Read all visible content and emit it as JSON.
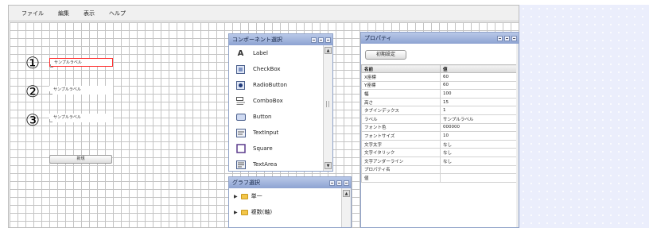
{
  "menu": [
    "ファイル",
    "編集",
    "表示",
    "ヘルプ"
  ],
  "canvas": {
    "markers": [
      "①",
      "②",
      "③"
    ],
    "labels": [
      "サンプルラベル",
      "サンプルラベル",
      "サンプルラベル"
    ],
    "button_label": "新規"
  },
  "components_panel": {
    "title": "コンポーネント選択",
    "items": [
      {
        "label": "Label",
        "icon": "label-a-icon"
      },
      {
        "label": "CheckBox",
        "icon": "checkbox-icon"
      },
      {
        "label": "RadioButton",
        "icon": "radio-button-icon"
      },
      {
        "label": "ComboBox",
        "icon": "combobox-icon"
      },
      {
        "label": "Button",
        "icon": "button-icon"
      },
      {
        "label": "TextInput",
        "icon": "text-input-icon"
      },
      {
        "label": "Square",
        "icon": "square-icon"
      },
      {
        "label": "TextArea",
        "icon": "text-area-icon"
      }
    ]
  },
  "graph_panel": {
    "title": "グラフ選択",
    "items": [
      "単一",
      "複数(軸)"
    ]
  },
  "properties_panel": {
    "title": "プロパティ",
    "button_label": "初期設定",
    "headers": [
      "名前",
      "値"
    ],
    "rows": [
      [
        "X座標",
        "60"
      ],
      [
        "Y座標",
        "60"
      ],
      [
        "幅",
        "100"
      ],
      [
        "高さ",
        "15"
      ],
      [
        "タブインデックス",
        "1"
      ],
      [
        "ラベル",
        "サンプルラベル"
      ],
      [
        "フォント色",
        "000000"
      ],
      [
        "フォントサイズ",
        "10"
      ],
      [
        "文字太字",
        "なし"
      ],
      [
        "文字イタリック",
        "なし"
      ],
      [
        "文字アンダーライン",
        "なし"
      ],
      [
        "プロパティ名",
        ""
      ],
      [
        "値",
        ""
      ]
    ]
  },
  "colors": {
    "selection_border": "#ff2a2a",
    "panel_title": "#8da3d2",
    "background_dots": "#ebeefc",
    "folder": "#f3c64a"
  }
}
